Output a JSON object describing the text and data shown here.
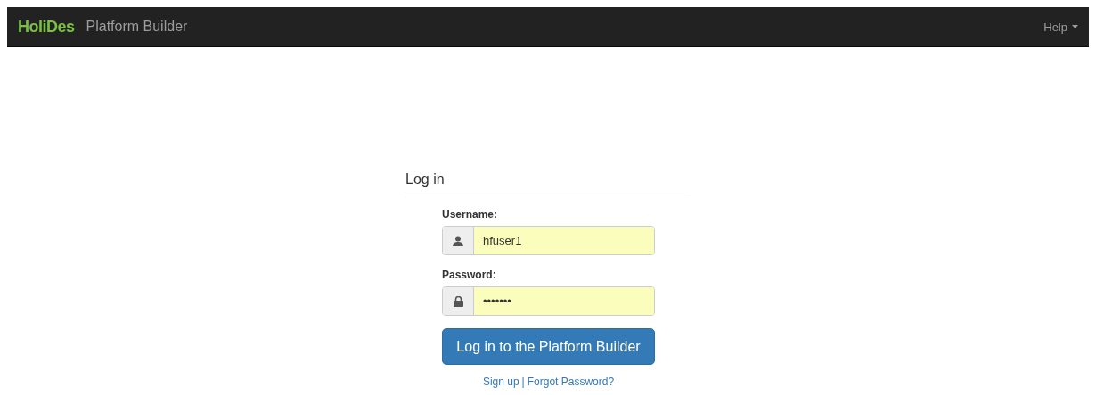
{
  "navbar": {
    "brand": "HoliDes",
    "title": "Platform Builder",
    "help_menu": {
      "label": "Help",
      "expanded": false
    }
  },
  "login": {
    "heading": "Log in",
    "fields": [
      {
        "kind": "user",
        "label": "Username:",
        "value": "hfuser1"
      },
      {
        "kind": "lock",
        "label": "Password:",
        "value": "•••••••"
      }
    ],
    "submit": "Log in to the Platform Builder",
    "links": [
      {
        "label": "Sign up"
      },
      {
        "label": "Forgot Password?"
      }
    ],
    "link_separator": "|"
  }
}
